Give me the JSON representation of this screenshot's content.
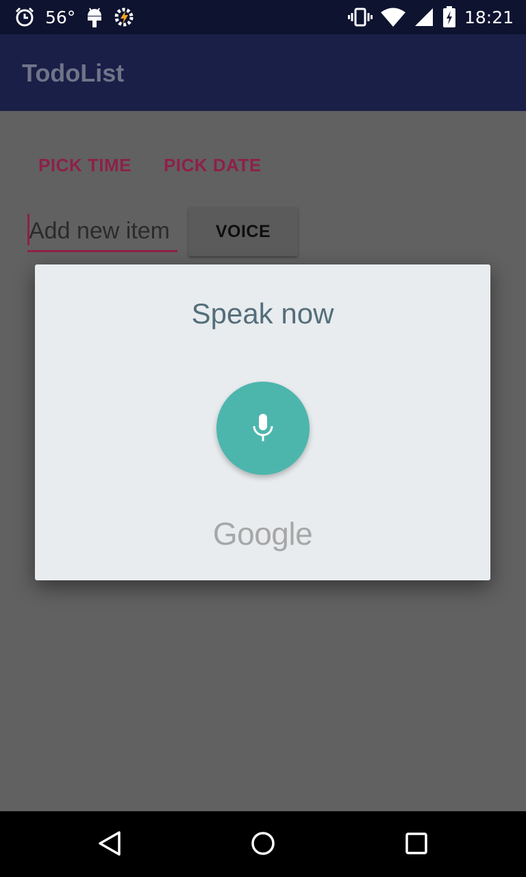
{
  "status_bar": {
    "temperature": "56°",
    "time": "18:21",
    "icons": [
      "alarm-icon",
      "android-icon",
      "tasker-icon",
      "vibrate-icon",
      "wifi-icon",
      "signal-icon",
      "battery-icon"
    ]
  },
  "toolbar": {
    "title": "TodoList"
  },
  "actions": {
    "pick_time": "PICK TIME",
    "pick_date": "PICK DATE"
  },
  "input": {
    "placeholder": "Add new item",
    "value": ""
  },
  "voice_button": {
    "label": "VOICE"
  },
  "voice_dialog": {
    "prompt": "Speak now",
    "brand": "Google",
    "mic_icon": "microphone-icon"
  },
  "nav_bar": {
    "icons": [
      "back-icon",
      "home-icon",
      "recents-icon"
    ]
  },
  "colors": {
    "status_bar": "#0e1330",
    "toolbar": "#1a1f48",
    "accent": "#8e2048",
    "mic": "#4db6ac",
    "dialog": "#e8ecef",
    "scrim": "#616161"
  }
}
